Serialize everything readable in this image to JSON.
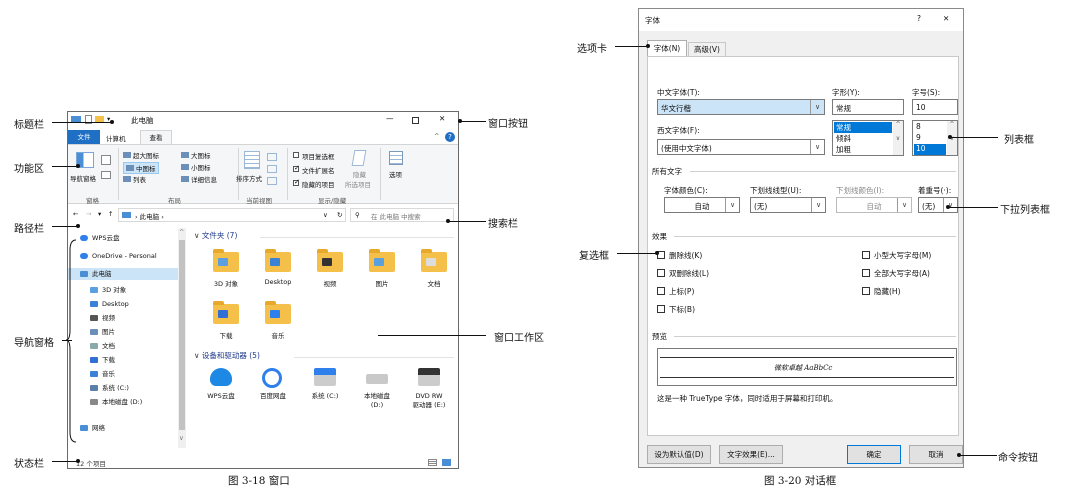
{
  "explorer": {
    "title": "此电脑",
    "tabs": [
      "文件",
      "计算机",
      "查看"
    ],
    "ribbon": {
      "nav_pane": "导航窗格",
      "layout_items": [
        "超大图标",
        "大图标",
        "中图标",
        "小图标",
        "列表",
        "详细信息"
      ],
      "sort": "排序方式",
      "checks": [
        "项目复选框",
        "文件扩展名",
        "隐藏的项目"
      ],
      "hide": "隐藏",
      "hide_sub": "所选项目",
      "options": "选项",
      "groups": [
        "窗格",
        "布局",
        "当前视图",
        "显示/隐藏"
      ]
    },
    "address": "此电脑",
    "search_placeholder": "在 此电脑 中搜索",
    "nav_items": [
      "WPS云盘",
      "OneDrive - Personal",
      "此电脑",
      "3D 对象",
      "Desktop",
      "视频",
      "图片",
      "文档",
      "下载",
      "音乐",
      "系统 (C:)",
      "本地磁盘 (D:)",
      "网络"
    ],
    "folders_header": "文件夹 (7)",
    "folders": [
      "3D 对象",
      "Desktop",
      "视频",
      "图片",
      "文档",
      "下载",
      "音乐"
    ],
    "devices_header": "设备和驱动器 (5)",
    "devices": [
      "WPS云盘",
      "百度网盘",
      "系统 (C:)",
      "本地磁盘\n(D:)",
      "DVD RW\n驱动器 (E:)"
    ],
    "status": "12 个项目"
  },
  "dialog": {
    "title": "字体",
    "help": "?",
    "close": "✕",
    "tabs": [
      "字体(N)",
      "高级(V)"
    ],
    "cn_font_label": "中文字体(T):",
    "cn_font_value": "华文行楷",
    "style_label": "字形(Y):",
    "style_value": "常规",
    "size_label": "字号(S):",
    "size_value": "10",
    "west_font_label": "西文字体(F):",
    "west_font_value": "(使用中文字体)",
    "style_list": [
      "常规",
      "倾斜",
      "加粗"
    ],
    "size_list": [
      "8",
      "9",
      "10"
    ],
    "all_text": "所有文字",
    "color_label": "字体颜色(C):",
    "color_value": "自动",
    "underline_label": "下划线线型(U):",
    "underline_value": "(无)",
    "ucolor_label": "下划线颜色(I):",
    "ucolor_value": "自动",
    "emph_label": "着重号(·):",
    "emph_value": "(无)",
    "effects": "效果",
    "effects_left": [
      "删除线(K)",
      "双删除线(L)",
      "上标(P)",
      "下标(B)"
    ],
    "effects_right": [
      "小型大写字母(M)",
      "全部大写字母(A)",
      "隐藏(H)"
    ],
    "preview_label": "预览",
    "preview_text": "微软卓越 AaBbCc",
    "note": "这是一种 TrueType 字体，同时适用于屏幕和打印机。",
    "buttons": [
      "设为默认值(D)",
      "文字效果(E)...",
      "确定",
      "取消"
    ]
  },
  "annotations_left": {
    "title_bar": "标题栏",
    "ribbon": "功能区",
    "path": "路径栏",
    "nav": "导航窗格",
    "status": "状态栏",
    "win_buttons": "窗口按钮",
    "search": "搜索栏",
    "workspace": "窗口工作区"
  },
  "annotations_right": {
    "tab": "选项卡",
    "list": "列表框",
    "dropdown": "下拉列表框",
    "checkbox": "复选框",
    "cmd": "命令按钮"
  },
  "captions": {
    "left": "图 3-18   窗口",
    "right": "图 3-20   对话框"
  }
}
